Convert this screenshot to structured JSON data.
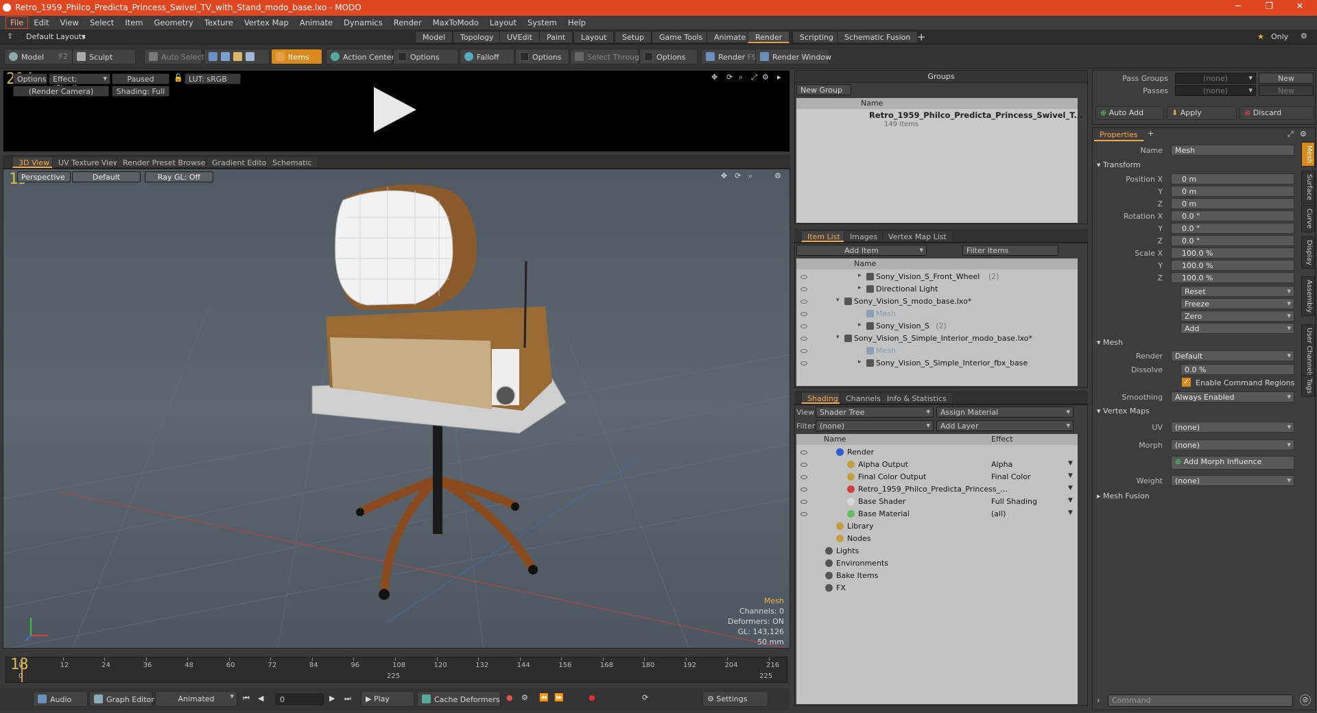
{
  "window": {
    "title": "Retro_1959_Philco_Predicta_Princess_Swivel_TV_with_Stand_modo_base.lxo - MODO"
  },
  "menu": [
    "File",
    "Edit",
    "View",
    "Select",
    "Item",
    "Geometry",
    "Texture",
    "Vertex Map",
    "Animate",
    "Dynamics",
    "Render",
    "MaxToModo",
    "Layout",
    "System",
    "Help"
  ],
  "layouts": {
    "default_label": "Default Layouts",
    "tabs": [
      "Model",
      "Topology",
      "UVEdit",
      "Paint",
      "Layout",
      "Setup",
      "Game Tools",
      "Animate",
      "Render",
      "Scripting",
      "Schematic Fusion"
    ],
    "active": "Render",
    "only_label": "Only"
  },
  "toolbar": {
    "model": "Model",
    "model_key": "F2",
    "sculpt": "Sculpt",
    "auto_select": "Auto Select",
    "items": "Items",
    "action_center": "Action Center",
    "options1": "Options",
    "falloff": "Falloff",
    "options2": "Options",
    "select_through": "Select Through",
    "options3": "Options",
    "render": "Render",
    "render_key": "F9",
    "render_window": "Render Window"
  },
  "preview": {
    "counter": "214",
    "options": "Options",
    "effect": "Effect: (Shadi...",
    "paused": "Paused",
    "lut": "LUT: sRGB",
    "camera": "(Render Camera)",
    "shading": "Shading: Full"
  },
  "viewport": {
    "tabs": [
      "3D View",
      "UV Texture View",
      "Render Preset Browser",
      "Gradient Editor",
      "Schematic"
    ],
    "active": "3D View",
    "counter": "15",
    "perspective": "Perspective",
    "default": "Default",
    "raygl": "Ray GL: Off",
    "info": {
      "mesh": "Mesh",
      "channels": "Channels: 0",
      "deformers": "Deformers: ON",
      "gl": "GL: 143,126",
      "focal": "50 mm"
    }
  },
  "timeline": {
    "ticks": [
      "0",
      "12",
      "24",
      "36",
      "48",
      "60",
      "72",
      "84",
      "96",
      "108",
      "120",
      "132",
      "144",
      "156",
      "168",
      "180",
      "192",
      "204",
      "216"
    ],
    "lower": [
      "0",
      "225",
      "225"
    ],
    "counter": "18"
  },
  "transport": {
    "audio": "Audio",
    "graph_editor": "Graph Editor",
    "animated": "Animated",
    "frame": "0",
    "play": "Play",
    "cache": "Cache Deformers",
    "settings": "Settings"
  },
  "groups": {
    "title": "Groups",
    "new_group": "New Group",
    "name_col": "Name",
    "item": "Retro_1959_Philco_Predicta_Princess_Swivel_T...",
    "count": "149 Items"
  },
  "itemlist": {
    "tabs": [
      "Item List",
      "Images",
      "Vertex Map List"
    ],
    "active": "Item List",
    "add_item": "Add Item",
    "filter": "Filter Items",
    "name_col": "Name",
    "rows": [
      {
        "text": "Sony_Vision_S_Front_Wheel",
        "suffix": "(2)",
        "indent": 5,
        "dim": false
      },
      {
        "text": "Directional Light",
        "suffix": "",
        "indent": 5,
        "dim": false
      },
      {
        "text": "Sony_Vision_S_modo_base.lxo*",
        "suffix": "",
        "indent": 3,
        "dim": false
      },
      {
        "text": "Mesh",
        "suffix": "",
        "indent": 5,
        "dim": true
      },
      {
        "text": "Sony_Vision_S",
        "suffix": "(2)",
        "indent": 5,
        "dim": false
      },
      {
        "text": "Sony_Vision_S_Simple_Interior_modo_base.lxo*",
        "suffix": "",
        "indent": 3,
        "dim": false
      },
      {
        "text": "Mesh",
        "suffix": "",
        "indent": 5,
        "dim": true
      },
      {
        "text": "Sony_Vision_S_Simple_Interior_fbx_base",
        "suffix": "",
        "indent": 5,
        "dim": false
      }
    ]
  },
  "shading": {
    "tabs": [
      "Shading",
      "Channels",
      "Info & Statistics"
    ],
    "active": "Shading",
    "view_label": "View",
    "view_value": "Shader Tree",
    "assign": "Assign Material",
    "filter_label": "Filter",
    "filter_value": "(none)",
    "add_layer": "Add Layer",
    "name_col": "Name",
    "effect_col": "Effect",
    "rows": [
      {
        "name": "Render",
        "effect": "",
        "indent": 1
      },
      {
        "name": "Alpha Output",
        "effect": "Alpha",
        "indent": 2
      },
      {
        "name": "Final Color Output",
        "effect": "Final Color",
        "indent": 2
      },
      {
        "name": "Retro_1959_Philco_Predicta_Princess_...",
        "effect": "",
        "indent": 2
      },
      {
        "name": "Base Shader",
        "effect": "Full Shading",
        "indent": 2
      },
      {
        "name": "Base Material",
        "effect": "(all)",
        "indent": 2
      },
      {
        "name": "Library",
        "effect": "",
        "indent": 1
      },
      {
        "name": "Nodes",
        "effect": "",
        "indent": 1
      },
      {
        "name": "Lights",
        "effect": "",
        "indent": 0
      },
      {
        "name": "Environments",
        "effect": "",
        "indent": 0
      },
      {
        "name": "Bake Items",
        "effect": "",
        "indent": 0
      },
      {
        "name": "FX",
        "effect": "",
        "indent": 0
      }
    ]
  },
  "passes": {
    "pass_groups": "Pass Groups",
    "passes": "Passes",
    "none": "(none)",
    "new": "New",
    "auto_add": "Auto Add",
    "apply": "Apply",
    "discard": "Discard"
  },
  "properties": {
    "tab": "Properties",
    "name_label": "Name",
    "name_value": "Mesh",
    "transform": "Transform",
    "position_label": "Position X",
    "rotation_label": "Rotation X",
    "scale_label": "Scale X",
    "y": "Y",
    "z": "Z",
    "pos": [
      "0 m",
      "0 m",
      "0 m"
    ],
    "rot": [
      "0.0 °",
      "0.0 °",
      "0.0 °"
    ],
    "scl": [
      "100.0 %",
      "100.0 %",
      "100.0 %"
    ],
    "reset": "Reset",
    "freeze": "Freeze",
    "zero": "Zero",
    "add": "Add",
    "mesh_section": "Mesh",
    "render_label": "Render",
    "render_value": "Default",
    "dissolve_label": "Dissolve",
    "dissolve_value": "0.0 %",
    "enable_cmd": "Enable Command Regions",
    "smoothing_label": "Smoothing",
    "smoothing_value": "Always Enabled",
    "vertex_maps": "Vertex Maps",
    "uv_label": "UV",
    "uv_value": "(none)",
    "morph_label": "Morph",
    "morph_value": "(none)",
    "add_morph": "Add Morph Influence",
    "weight_label": "Weight",
    "weight_value": "(none)",
    "mesh_fusion": "Mesh Fusion",
    "side_tabs": [
      "Mesh",
      "Surface",
      "Curve",
      "Display",
      "Assembly",
      "User Channels",
      "Tags"
    ],
    "command_placeholder": "Command"
  }
}
